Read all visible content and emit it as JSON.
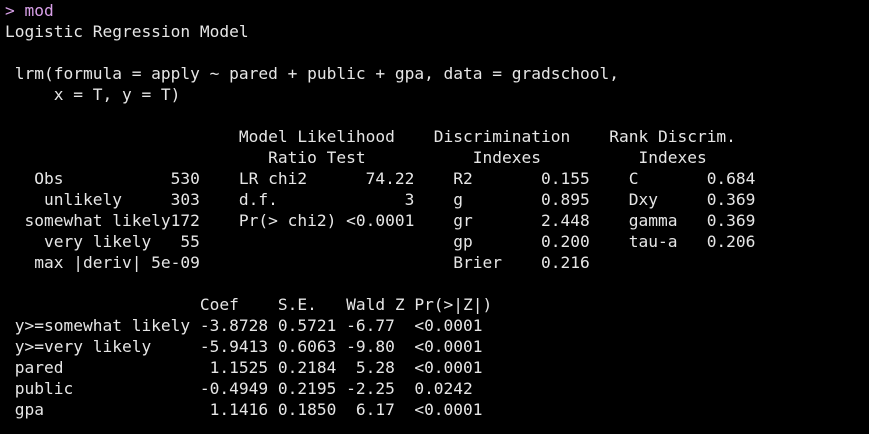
{
  "colors": {
    "background": "#000000",
    "output_text": "#e6e6e6",
    "prompt_text": "#d8a0e8"
  },
  "console": {
    "lines": [
      {
        "text": "> mod",
        "type": "input"
      },
      {
        "text": "Logistic Regression Model",
        "type": "output"
      },
      {
        "text": "",
        "type": "output"
      },
      {
        "text": " lrm(formula = apply ~ pared + public + gpa, data = gradschool,",
        "type": "output"
      },
      {
        "text": "     x = T, y = T)",
        "type": "output"
      },
      {
        "text": "",
        "type": "output"
      },
      {
        "text": "                        Model Likelihood    Discrimination    Rank Discrim.",
        "type": "output"
      },
      {
        "text": "                           Ratio Test           Indexes          Indexes",
        "type": "output"
      },
      {
        "text": "   Obs           530    LR chi2      74.22    R2       0.155    C       0.684",
        "type": "output"
      },
      {
        "text": "    unlikely     303    d.f.             3    g        0.895    Dxy     0.369",
        "type": "output"
      },
      {
        "text": "  somewhat likely172    Pr(> chi2) <0.0001    gr       2.448    gamma   0.369",
        "type": "output"
      },
      {
        "text": "    very likely   55                          gp       0.200    tau-a   0.206",
        "type": "output"
      },
      {
        "text": "   max |deriv| 5e-09                          Brier    0.216",
        "type": "output"
      },
      {
        "text": "",
        "type": "output"
      },
      {
        "text": "                    Coef    S.E.   Wald Z Pr(>|Z|)",
        "type": "output"
      },
      {
        "text": " y>=somewhat likely -3.8728 0.5721 -6.77  <0.0001",
        "type": "output"
      },
      {
        "text": " y>=very likely     -5.9413 0.6063 -9.80  <0.0001",
        "type": "output"
      },
      {
        "text": " pared               1.1525 0.2184  5.28  <0.0001",
        "type": "output"
      },
      {
        "text": " public             -0.4949 0.2195 -2.25  0.0242",
        "type": "output"
      },
      {
        "text": " gpa                 1.1416 0.1850  6.17  <0.0001",
        "type": "output"
      }
    ]
  }
}
